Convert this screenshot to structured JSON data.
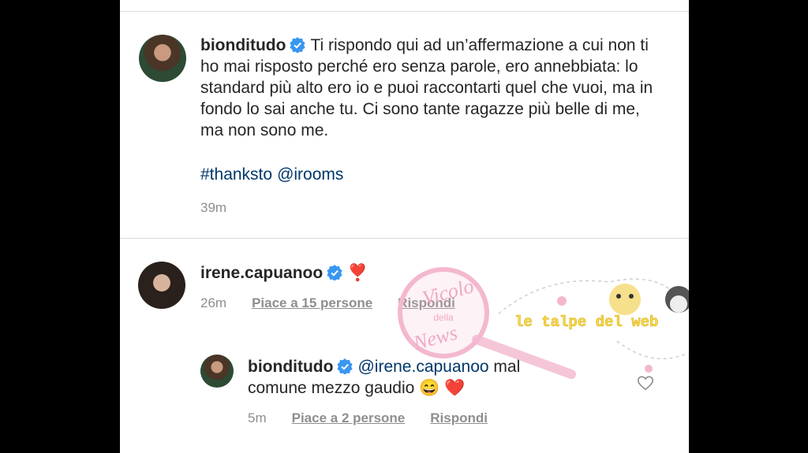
{
  "post": {
    "username": "bionditudo",
    "caption": "Ti rispondo qui ad un’affermazione a cui non ti ho mai risposto perché ero senza parole, ero annebbiata: lo standard più alto ero io e puoi raccontarti quel che vuoi, ma in fondo lo sai anche tu. Ci sono tante ragazze più belle di me, ma non sono me.",
    "hashtag": "#thanksto",
    "mention": "@irooms",
    "time": "39m"
  },
  "comment": {
    "username": "irene.capuanoo",
    "text": "❣️",
    "time": "26m",
    "likes": "Piace a 15 persone",
    "reply_label": "Rispondi"
  },
  "reply": {
    "username": "bionditudo",
    "mention": "@irene.capuanoo",
    "text_line1": "mal",
    "text_line2": "comune mezzo gaudio 😄 ❤️",
    "time": "5m",
    "likes": "Piace a 2 persone",
    "reply_label": "Rispondi"
  },
  "watermarks": {
    "stamp_line1": "Vicolo",
    "stamp_line2": "della",
    "stamp_line3": "News",
    "tagline": "le talpe del web"
  },
  "colors": {
    "link": "#00376b",
    "muted": "#8e8e8e",
    "verified": "#3897f0",
    "watermark": "#f3b8cf"
  },
  "icons": [
    "verified-badge-icon",
    "heart-outline-icon"
  ]
}
